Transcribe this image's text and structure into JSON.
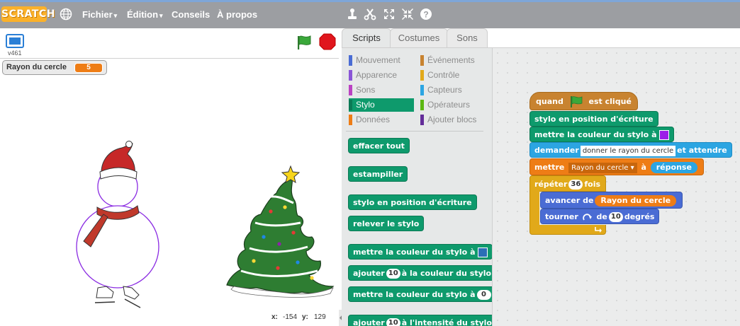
{
  "menubar": {
    "logo": "SCRATCH",
    "items": [
      {
        "label": "Fichier",
        "caret": "▾"
      },
      {
        "label": "Édition",
        "caret": "▾"
      },
      {
        "label": "Conseils",
        "caret": ""
      },
      {
        "label": "À propos",
        "caret": ""
      }
    ],
    "tool_icons": [
      "duplicate-icon",
      "cut-icon",
      "grow-icon",
      "shrink-icon",
      "help-icon"
    ]
  },
  "stage": {
    "version": "v461",
    "monitor": {
      "name": "Rayon du cercle",
      "value": "5"
    },
    "coords": {
      "x_label": "x:",
      "x_value": "-154",
      "y_label": "y:",
      "y_value": "129"
    }
  },
  "tabs": [
    "Scripts",
    "Costumes",
    "Sons"
  ],
  "palette": {
    "categories_left": [
      {
        "label": "Mouvement",
        "color": "#4a6cd4"
      },
      {
        "label": "Apparence",
        "color": "#8a55d7"
      },
      {
        "label": "Sons",
        "color": "#bb42c3"
      },
      {
        "label": "Stylo",
        "color": "#0e9a6c"
      },
      {
        "label": "Données",
        "color": "#ee7d16"
      }
    ],
    "categories_right": [
      {
        "label": "Événements",
        "color": "#c88330"
      },
      {
        "label": "Contrôle",
        "color": "#e1a91a"
      },
      {
        "label": "Capteurs",
        "color": "#2ca5e2"
      },
      {
        "label": "Opérateurs",
        "color": "#5cb712"
      },
      {
        "label": "Ajouter blocs",
        "color": "#632d99"
      }
    ],
    "active_category": "Stylo",
    "blocks": {
      "clear": "effacer tout",
      "stamp": "estampiller",
      "pen_down": "stylo en position d'écriture",
      "pen_up": "relever le stylo",
      "set_color": "mettre la couleur du stylo à",
      "change_color_a": "ajouter",
      "change_color_val": "10",
      "change_color_b": "à la couleur du stylo",
      "set_color_num": "mettre la couleur du stylo à",
      "set_color_num_val": "0",
      "change_shade_a": "ajouter",
      "change_shade_val": "10",
      "change_shade_b": "à l'intensité du stylo"
    }
  },
  "script": {
    "hat_a": "quand",
    "hat_b": "est cliqué",
    "pen_down": "stylo en position d'écriture",
    "set_color": "mettre la couleur du stylo à",
    "ask_a": "demander",
    "ask_value": "donner le rayon du cercle",
    "ask_b": "et attendre",
    "set_a": "mettre",
    "set_var": "Rayon du cercle",
    "set_b": "à",
    "set_value": "réponse",
    "repeat_a": "répéter",
    "repeat_value": "36",
    "repeat_b": "fois",
    "move_a": "avancer de",
    "move_value": "Rayon du cercle",
    "turn_a": "tourner",
    "turn_b": "de",
    "turn_value": "10",
    "turn_c": "degrés"
  },
  "colors": {
    "menubar": "#9c9ea2",
    "pen": "#0e9a6c",
    "motion": "#4a6cd4",
    "events": "#c88330",
    "control": "#e1a91a",
    "sensing": "#2ca5e2",
    "data": "#ee7d16",
    "pen_swatch_palette": "#2b6fb6",
    "pen_swatch_script": "#9b1fe8"
  }
}
